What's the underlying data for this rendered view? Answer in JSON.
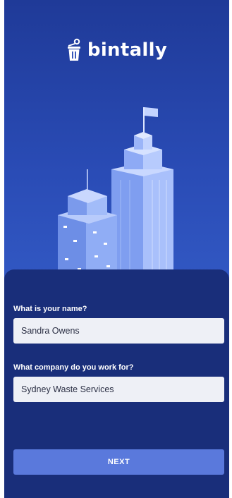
{
  "app": {
    "brand": "bintally",
    "logo_icon": "bin-icon"
  },
  "form": {
    "name_question": "What is your name?",
    "name_value": "Sandra Owens",
    "company_question": "What company do you work for?",
    "company_value": "Sydney Waste Services",
    "next_label": "NEXT"
  },
  "colors": {
    "background_top": "#1f3a98",
    "background_mid": "#3157c2",
    "panel": "#192e7a",
    "input_background": "#eef0f6",
    "button": "#5a79dc"
  }
}
